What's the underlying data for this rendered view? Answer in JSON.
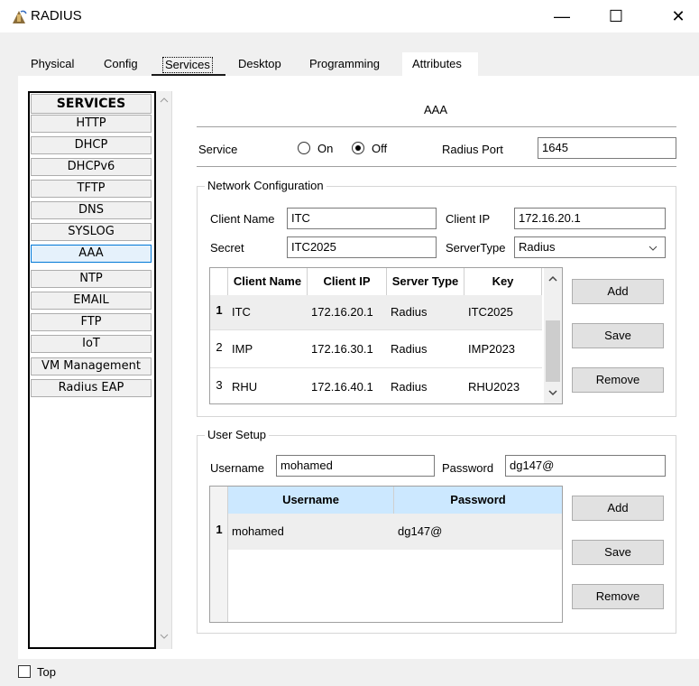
{
  "window": {
    "title": "RADIUS",
    "minimize_glyph": "—",
    "maximize_glyph": "☐",
    "close_glyph": "✕"
  },
  "tabs": [
    {
      "label": "Physical"
    },
    {
      "label": "Config"
    },
    {
      "label": "Services",
      "active": true
    },
    {
      "label": "Desktop"
    },
    {
      "label": "Programming"
    },
    {
      "label": "Attributes"
    }
  ],
  "services": {
    "header": "SERVICES",
    "items": [
      "HTTP",
      "DHCP",
      "DHCPv6",
      "TFTP",
      "DNS",
      "SYSLOG",
      "AAA",
      "NTP",
      "EMAIL",
      "FTP",
      "IoT",
      "VM Management",
      "Radius EAP"
    ],
    "selected": "AAA"
  },
  "aaa": {
    "title": "AAA",
    "service_label": "Service",
    "on_label": "On",
    "off_label": "Off",
    "service_state": "Off",
    "radius_port_label": "Radius Port",
    "radius_port_value": "1645"
  },
  "network_config": {
    "title": "Network Configuration",
    "client_name_label": "Client Name",
    "client_name_value": "ITC",
    "client_ip_label": "Client IP",
    "client_ip_value": "172.16.20.1",
    "secret_label": "Secret",
    "secret_value": "ITC2025",
    "server_type_label": "ServerType",
    "server_type_value": "Radius",
    "columns": [
      "Client Name",
      "Client IP",
      "Server Type",
      "Key"
    ],
    "rows": [
      {
        "num": "1",
        "client_name": "ITC",
        "client_ip": "172.16.20.1",
        "server_type": "Radius",
        "key": "ITC2025"
      },
      {
        "num": "2",
        "client_name": "IMP",
        "client_ip": "172.16.30.1",
        "server_type": "Radius",
        "key": "IMP2023"
      },
      {
        "num": "3",
        "client_name": "RHU",
        "client_ip": "172.16.40.1",
        "server_type": "Radius",
        "key": "RHU2023"
      }
    ],
    "add_label": "Add",
    "save_label": "Save",
    "remove_label": "Remove"
  },
  "user_setup": {
    "title": "User Setup",
    "username_label": "Username",
    "username_value": "mohamed",
    "password_label": "Password",
    "password_value": "dg147@",
    "columns": [
      "Username",
      "Password"
    ],
    "rows": [
      {
        "num": "1",
        "username": "mohamed",
        "password": "dg147@"
      }
    ],
    "add_label": "Add",
    "save_label": "Save",
    "remove_label": "Remove"
  },
  "footer": {
    "top_checkbox_label": "Top",
    "top_checked": false
  },
  "colors": {
    "selected_row": "#eeeeee",
    "header_bg": "#cce8ff",
    "selected_service": "#e5f1fb"
  }
}
